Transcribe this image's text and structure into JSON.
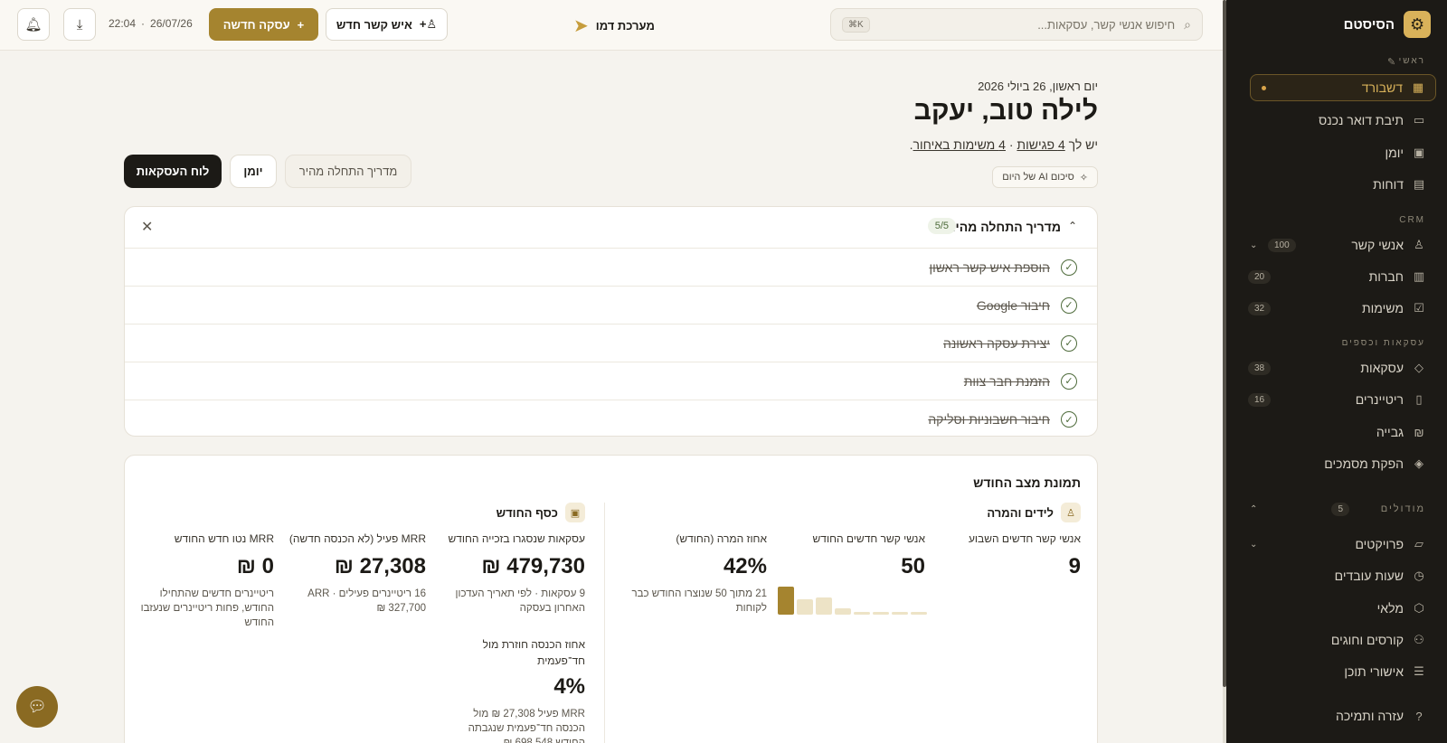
{
  "sidebar": {
    "brand_title": "הסיסטם",
    "sections": {
      "main": "ראשי",
      "crm": "CRM",
      "deals": "עסקאות וכספים",
      "modules": "מודולים"
    },
    "modules_count": "5",
    "items": [
      {
        "label": "דשבורד",
        "icon": "grid-icon"
      },
      {
        "label": "תיבת דואר נכנס",
        "icon": "inbox-icon"
      },
      {
        "label": "יומן",
        "icon": "calendar-icon"
      },
      {
        "label": "דוחות",
        "icon": "report-icon"
      },
      {
        "label": "אנשי קשר",
        "icon": "user-icon",
        "badge": "100"
      },
      {
        "label": "חברות",
        "icon": "building-icon",
        "badge": "20"
      },
      {
        "label": "משימות",
        "icon": "checkbox-icon",
        "badge": "32"
      },
      {
        "label": "עסקאות",
        "icon": "tag-icon",
        "badge": "38"
      },
      {
        "label": "ריטיינרים",
        "icon": "document-icon",
        "badge": "16"
      },
      {
        "label": "גבייה",
        "icon": "shekel-icon"
      },
      {
        "label": "הפקת מסמכים",
        "icon": "layers-icon"
      },
      {
        "label": "פרויקטים",
        "icon": "folder-icon"
      },
      {
        "label": "שעות עובדים",
        "icon": "stopwatch-icon"
      },
      {
        "label": "מלאי",
        "icon": "box-icon"
      },
      {
        "label": "קורסים וחוגים",
        "icon": "people-icon"
      },
      {
        "label": "אישורי תוכן",
        "icon": "list-icon"
      },
      {
        "label": "עזרה ותמיכה",
        "icon": "help-icon"
      }
    ]
  },
  "topbar": {
    "search_placeholder": "חיפוש אנשי קשר, עסקאות...",
    "search_shortcut": "⌘K",
    "demo_label": "מערכת דמו",
    "new_contact": "איש קשר חדש",
    "new_deal": "עסקה חדשה",
    "date": "26/07/26",
    "time": "22:04"
  },
  "header": {
    "date_line": "יום ראשון, 26 ביולי 2026",
    "greeting": "לילה טוב, יעקב",
    "summary_prefix": "יש לך",
    "meetings": "4 פגישות",
    "tasks": "4 משימות באיחור",
    "ai_summary": "סיכום AI של היום"
  },
  "tabs": {
    "board": "לוח העסקאות",
    "calendar": "יומן",
    "guide": "מדריך התחלה מהיר"
  },
  "guide": {
    "title": "מדריך התחלה מהיר",
    "progress": "5/5",
    "steps": [
      "הוספת איש קשר ראשון",
      "חיבור Google",
      "יצירת עסקה ראשונה",
      "הזמנת חבר צוות",
      "חיבור חשבוניות וסליקה"
    ]
  },
  "status": {
    "title": "תמונת מצב החודש",
    "leads": {
      "title": "לידים והמרה",
      "week_contacts_label": "אנשי קשר חדשים השבוע",
      "week_contacts_value": "9",
      "month_contacts_label": "אנשי קשר חדשים החודש",
      "month_contacts_value": "50",
      "conversion_label": "אחוז המרה (החודש)",
      "conversion_value": "42%",
      "conversion_note": "21 מתוך 50 שנוצרו החודש כבר לקוחות",
      "weekly_bars": [
        0.9,
        0.5,
        0.55,
        0.2,
        0.08,
        0.08,
        0.08,
        0.08
      ]
    },
    "money": {
      "title": "כסף החודש",
      "won_label": "עסקאות שנסגרו בזכייה החודש",
      "won_value": "479,730 ₪",
      "won_note": "9 עסקאות · לפי תאריך העדכון האחרון בעסקה",
      "mrr_label": "MRR פעיל (לא הכנסה חדשה)",
      "mrr_value": "27,308 ₪",
      "mrr_note": "16 ריטיינרים פעילים · ARR 327,700 ₪",
      "net_label": "MRR נטו חדש החודש",
      "net_value": "0 ₪",
      "net_note": "ריטיינרים חדשים שהתחילו החודש, פחות ריטיינרים שנעזבו החודש",
      "recurring_label": "אחוז הכנסה חוזרת מול חד־פעמית",
      "recurring_value": "4%",
      "recurring_note": "MRR פעיל 27,308 ₪ מול הכנסה חד־פעמית שנגבתה החודש 698,548 ₪"
    }
  },
  "colors": {
    "accent": "#a5842f",
    "sidebar_bg": "#1c1a16",
    "success": "#4e6b3b"
  }
}
